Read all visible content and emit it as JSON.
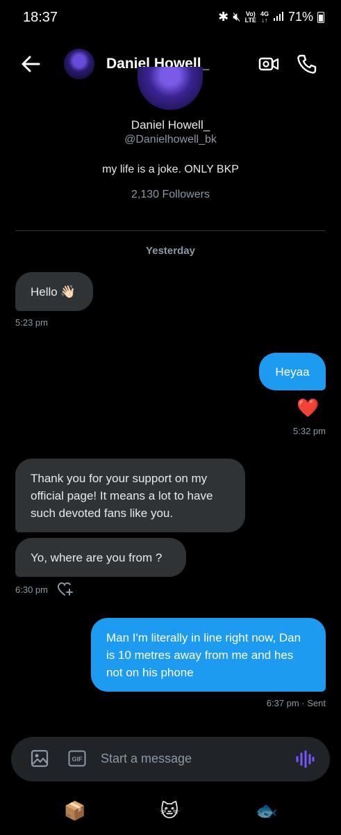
{
  "status_bar": {
    "time": "18:37",
    "net_top": "Vo)",
    "net_bottom": "LTE",
    "gen": "4G",
    "battery": "71%"
  },
  "header": {
    "name": "Daniel Howell_"
  },
  "profile": {
    "name": "Daniel Howell_",
    "handle": "@Danielhowell_bk",
    "bio": "my life is a joke. ONLY BKP",
    "followers": "2,130 Followers"
  },
  "conversation": {
    "day_label": "Yesterday",
    "m1": {
      "text": "Hello",
      "emoji": "👋🏻",
      "time": "5:23 pm"
    },
    "m2": {
      "text": "Heyaa",
      "reaction": "❤️",
      "time": "5:32 pm"
    },
    "m3": {
      "text": "Thank you for your support on my official page! It means a lot to have such devoted fans like you."
    },
    "m4": {
      "text": "Yo, where are you from ?",
      "time": "6:30 pm"
    },
    "m5": {
      "text": "Man I'm literally in line right now, Dan is 10 metres away from me and hes not on his phone",
      "time": "6:37 pm · Sent"
    }
  },
  "composer": {
    "placeholder": "Start a message",
    "gif_label": "GIF"
  },
  "bottom_nav": {
    "box": "📦",
    "cat": "🐱",
    "fish": "🐟"
  },
  "colors": {
    "accent": "#1d9bf0",
    "incoming": "#2f3336",
    "voice": "#7856ff"
  }
}
